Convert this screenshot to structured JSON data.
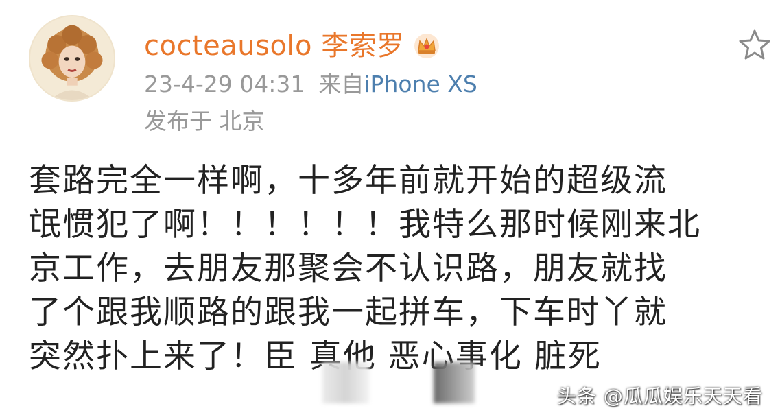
{
  "post": {
    "username": "cocteausolo 李索罗",
    "timestamp": "23-4-29 04:31",
    "source_prefix": "来自",
    "device": "iPhone XS",
    "location": "发布于 北京",
    "badge_icon": "crown-badge-icon",
    "favorite_icon": "star-outline-icon",
    "content_lines": [
      "套路完全一样啊，十多年前就开始的超级流",
      "氓惯犯了啊！！！！！！我特么那时候刚来北",
      "京工作，去朋友那聚会不认识路，朋友就找",
      "了个跟我顺路的跟我一起拼车，下车时丫就",
      "突然扑上来了！臣   真他   恶心事化  脏死"
    ]
  },
  "watermark": "头条 @瓜瓜娱乐天天看",
  "colors": {
    "username": "#e9772b",
    "meta": "#999999",
    "device": "#4d7fae",
    "content": "#222222"
  }
}
